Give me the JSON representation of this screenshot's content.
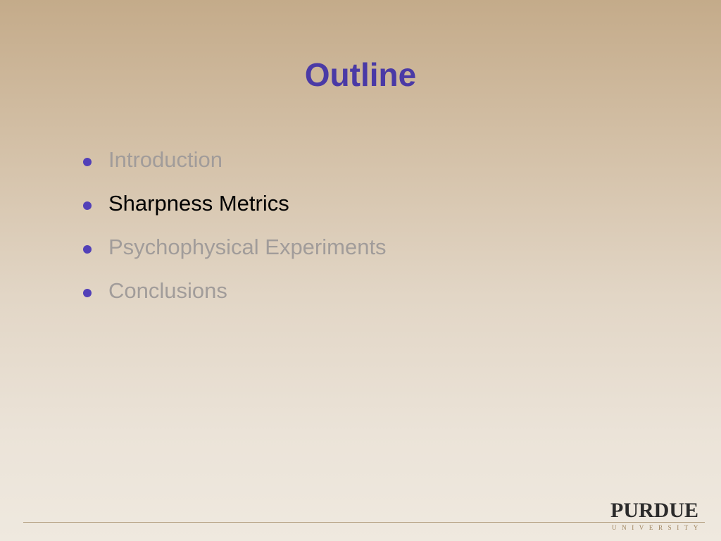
{
  "slide": {
    "title": "Outline",
    "bullets": [
      {
        "label": "Introduction",
        "active": false
      },
      {
        "label": "Sharpness Metrics",
        "active": true
      },
      {
        "label": "Psychophysical Experiments",
        "active": false
      },
      {
        "label": "Conclusions",
        "active": false
      }
    ]
  },
  "logo": {
    "name": "PURDUE",
    "subtitle": "UNIVERSITY"
  },
  "colors": {
    "title": "#4a3aa6",
    "bullet_dot": "#5240b8",
    "active_text": "#000000",
    "inactive_text": "#a19c9a",
    "rule": "#b6a385",
    "logo_text": "#2b2b2b",
    "logo_sub": "#9d835d"
  }
}
